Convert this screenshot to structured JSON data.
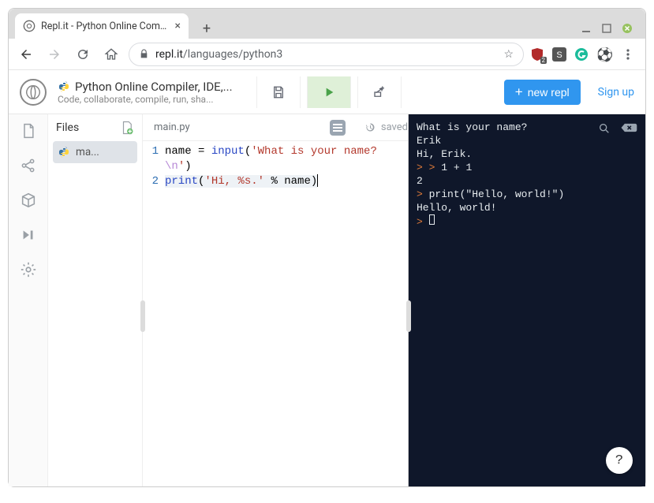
{
  "browser": {
    "tab_title": "Repl.it - Python Online Compil",
    "url_host": "repl.it",
    "url_path": "/languages/python3",
    "ublock_badge": "2"
  },
  "header": {
    "title": "Python Online Compiler, IDE,...",
    "subtitle": "Code, collaborate, compile, run, sha...",
    "new_repl_label": "new repl",
    "signup_label": "Sign up"
  },
  "files": {
    "heading": "Files",
    "items": [
      {
        "label": "ma..."
      }
    ]
  },
  "editor": {
    "tab_name": "main.py",
    "saved_label": "saved",
    "code": {
      "lines": [
        "1",
        "2"
      ],
      "l1_pre": "name = ",
      "l1_builtin": "input",
      "l1_paren_open": "(",
      "l1_str1": "'What is your name?",
      "l1_esc": "\\n",
      "l1_str1_end": "'",
      "l1_paren_close": ")",
      "l2_builtin": "print",
      "l2_paren_open": "(",
      "l2_str": "'Hi, %s.'",
      "l2_mid": " % name",
      "l2_paren_close": ")"
    }
  },
  "console": {
    "lines": [
      "What is your name?",
      "Erik",
      "Hi, Erik."
    ],
    "expr1_in": "1 + 1",
    "expr1_out": "2",
    "expr2_in": "print(\"Hello, world!\")",
    "expr2_out": "Hello, world!",
    "help": "?"
  }
}
